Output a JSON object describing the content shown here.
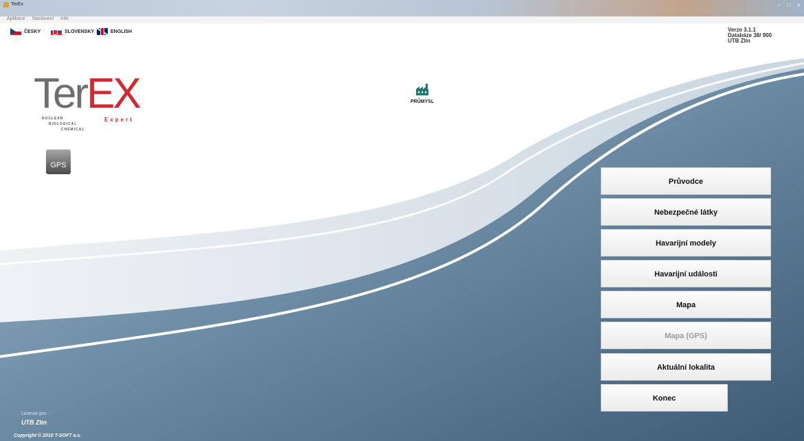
{
  "window": {
    "title": "TerEx"
  },
  "menu": {
    "items": [
      "Aplikace",
      "Nastavení",
      "Info"
    ]
  },
  "languages": {
    "czech": "ČESKY",
    "slovak": "SLOVENSKY",
    "english": "ENGLISH"
  },
  "version": {
    "line1": "Verze 3.1.1",
    "line2": "Databáze  38/ 900",
    "line3": "UTB Zlín"
  },
  "logo": {
    "ter": "Ter",
    "ex": "EX",
    "expert": "Expert",
    "nuclear": "NUCLEAR",
    "biological": "BIOLOGICAL",
    "chemical": "CHEMICAL"
  },
  "gps_button": "GPS",
  "industry_button": "PRŮMYSL",
  "main_menu": {
    "pruvodce": "Průvodce",
    "latky": "Nebezpečné látky",
    "modely": "Havarijní modely",
    "udalosti": "Havarijní události",
    "mapa": "Mapa",
    "mapa_gps": "Mapa (GPS)",
    "lokalita": "Aktuální lokalita",
    "konec": "Konec"
  },
  "footer": {
    "licence_label": "Licence pro :",
    "licence_name": "UTB Zlín",
    "copyright": "Copyright © 2010 T-SOFT a.s."
  },
  "colors": {
    "accent_red": "#d3282e",
    "logo_gray": "#6e6e6e",
    "wave_blue": "#5d7e98"
  }
}
